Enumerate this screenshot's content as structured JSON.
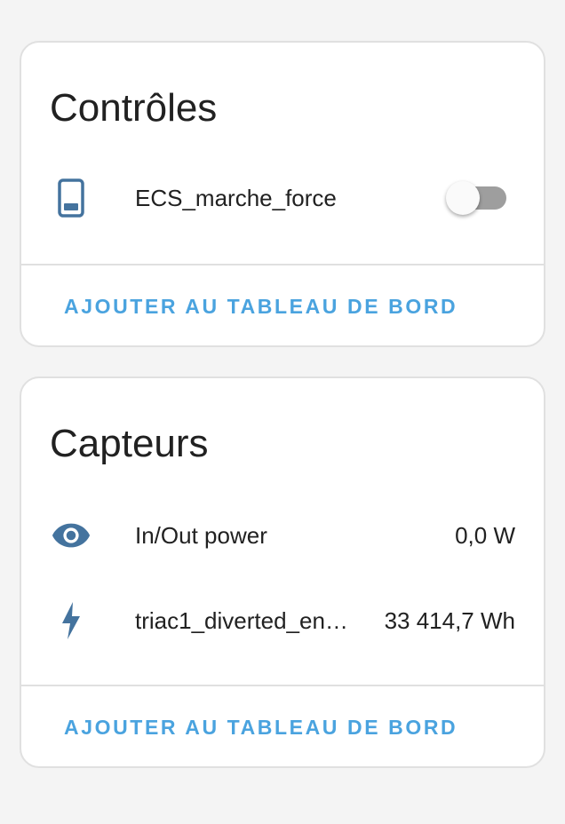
{
  "controls": {
    "title": "Contrôles",
    "items": [
      {
        "label": "ECS_marche_force",
        "icon": "cellphone-icon",
        "state": "off"
      }
    ],
    "action_label": "AJOUTER AU TABLEAU DE BORD"
  },
  "sensors": {
    "title": "Capteurs",
    "items": [
      {
        "label": "In/Out power",
        "value": "0,0 W",
        "icon": "eye-icon"
      },
      {
        "label": "triac1_diverted_en…",
        "value": "33 414,7 Wh",
        "icon": "flash-icon"
      }
    ],
    "action_label": "AJOUTER AU TABLEAU DE BORD"
  },
  "colors": {
    "accent": "#4aa3df",
    "icon": "#44739e",
    "background": "#f4f4f4",
    "card": "#ffffff"
  }
}
